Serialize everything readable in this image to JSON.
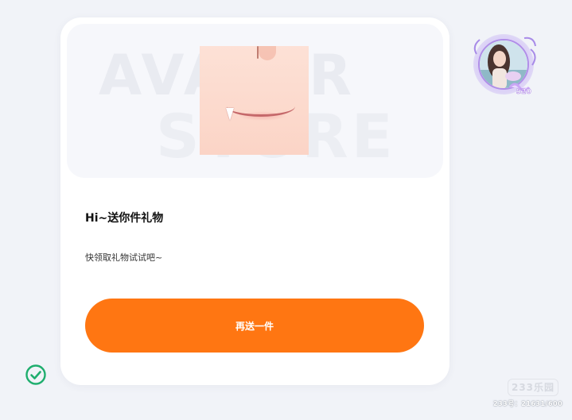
{
  "banner": {
    "watermark_line1": "AVATAR",
    "watermark_line2": "STORE"
  },
  "gift": {
    "title": "Hi~送你件礼物",
    "description": "快领取礼物试试吧~",
    "button_label": "再送一件"
  },
  "branding": {
    "site_logo": "233乐园",
    "site_id": "233号：21631/600"
  },
  "colors": {
    "accent": "#ff7612",
    "check": "#1fae6e",
    "background": "#f1f3f8",
    "card": "#ffffff"
  },
  "icons": {
    "status": "check-circle-icon"
  }
}
